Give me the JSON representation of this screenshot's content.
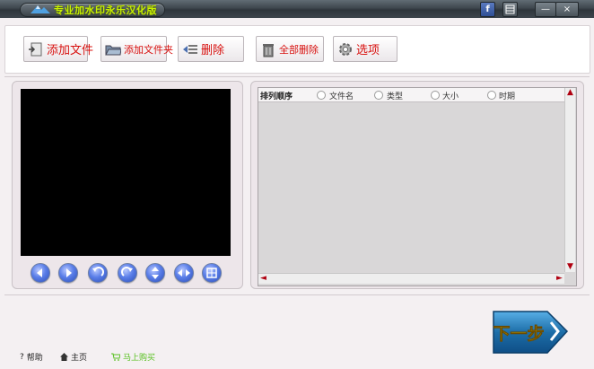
{
  "window": {
    "title": "专业加水印永乐汉化版",
    "facebook_label": "f",
    "minimize_label": "—",
    "close_label": "×"
  },
  "toolbar": {
    "add_file": "添加文件",
    "add_folder": "添加文件夹",
    "delete": "删除",
    "delete_all": "全部删除",
    "options": "选项"
  },
  "player": {
    "controls": [
      "prev-icon",
      "next-icon",
      "rotate-left-icon",
      "rotate-right-icon",
      "flip-icon",
      "mirror-icon",
      "fit-icon"
    ]
  },
  "file_list": {
    "sort_label": "排列顺序",
    "sort_options": [
      "文件名",
      "类型",
      "大小",
      "时期"
    ]
  },
  "footer": {
    "help": "帮助",
    "home": "主页",
    "buy": "马上购买",
    "next": "下一步"
  },
  "colors": {
    "title_text": "#c8f000",
    "toolbar_label": "#d8100e",
    "buy_link": "#58c020",
    "next_button": "#1d6ea8"
  }
}
